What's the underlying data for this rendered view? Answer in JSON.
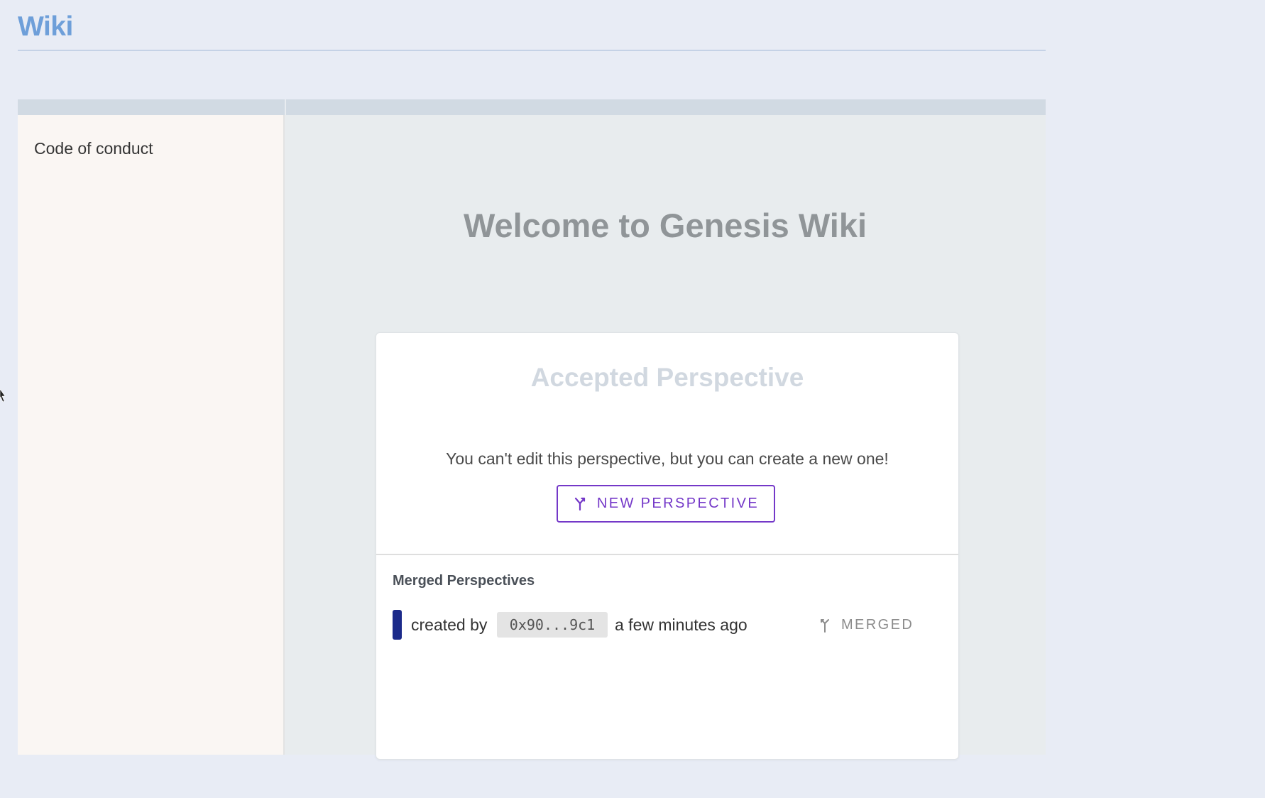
{
  "header": {
    "title": "Wiki"
  },
  "sidebar": {
    "items": [
      {
        "label": "Code of conduct"
      }
    ]
  },
  "main": {
    "welcome_title": "Welcome to Genesis Wiki"
  },
  "card": {
    "title": "Accepted Perspective",
    "message": "You can't edit this perspective, but you can create a new one!",
    "new_perspective_label": "NEW PERSPECTIVE",
    "new_perspective_icon": "fork-icon",
    "merged_heading": "Merged Perspectives",
    "merged_items": [
      {
        "created_by_label": "created by",
        "address": "0x90...9c1",
        "timestamp": "a few minutes ago",
        "status": "MERGED",
        "status_icon": "merge-icon",
        "color": "#1b2a8a"
      }
    ]
  },
  "colors": {
    "accent": "#7438c8",
    "wiki_title": "#6e9fd9",
    "perspective_color": "#1b2a8a"
  }
}
